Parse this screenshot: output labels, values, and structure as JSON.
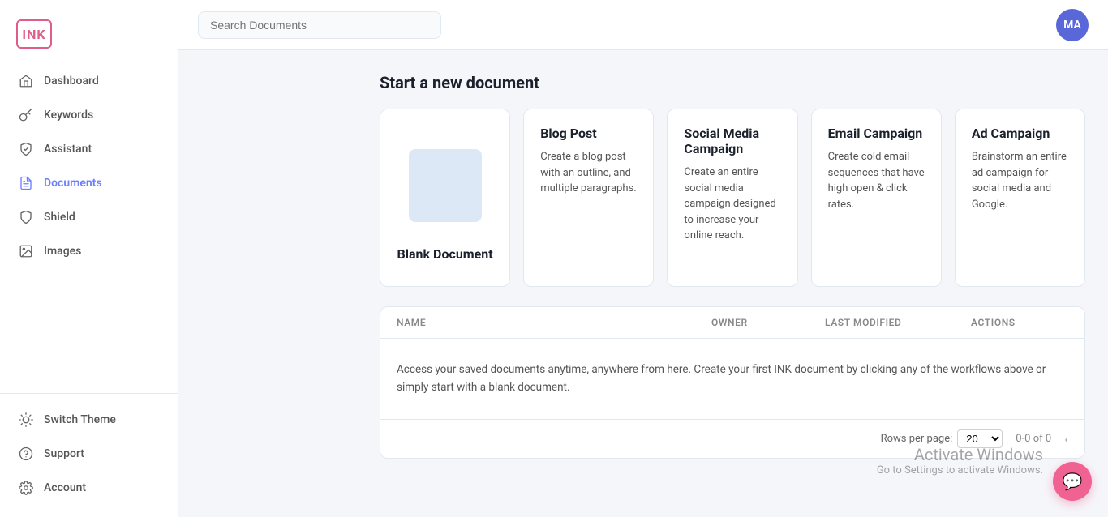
{
  "logo": {
    "text": "INK"
  },
  "topbar": {
    "search_placeholder": "Search Documents",
    "avatar_initials": "MA"
  },
  "sidebar": {
    "nav_items": [
      {
        "id": "dashboard",
        "label": "Dashboard",
        "icon": "home",
        "active": false
      },
      {
        "id": "keywords",
        "label": "Keywords",
        "icon": "key",
        "active": false
      },
      {
        "id": "assistant",
        "label": "Assistant",
        "icon": "shield-check",
        "active": false
      },
      {
        "id": "documents",
        "label": "Documents",
        "icon": "file",
        "active": true
      },
      {
        "id": "shield",
        "label": "Shield",
        "icon": "shield",
        "active": false
      },
      {
        "id": "images",
        "label": "Images",
        "icon": "image",
        "active": false
      }
    ],
    "bottom_items": [
      {
        "id": "switch-theme",
        "label": "Switch Theme",
        "icon": "sun"
      },
      {
        "id": "support",
        "label": "Support",
        "icon": "help-circle"
      },
      {
        "id": "account",
        "label": "Account",
        "icon": "settings"
      }
    ]
  },
  "main": {
    "section_title": "Start a new document",
    "cards": [
      {
        "id": "blank",
        "title": "Blank Document",
        "desc": "",
        "is_blank": true
      },
      {
        "id": "blog-post",
        "title": "Blog Post",
        "desc": "Create a blog post with an outline, and multiple paragraphs.",
        "is_blank": false
      },
      {
        "id": "social-media",
        "title": "Social Media Campaign",
        "desc": "Create an entire social media campaign designed to increase your online reach.",
        "is_blank": false
      },
      {
        "id": "email-campaign",
        "title": "Email Campaign",
        "desc": "Create cold email sequences that have high open & click rates.",
        "is_blank": false
      },
      {
        "id": "ad-campaign",
        "title": "Ad Campaign",
        "desc": "Brainstorm an entire ad campaign for social media and Google.",
        "is_blank": false
      }
    ],
    "table": {
      "columns": [
        "Name",
        "Owner",
        "Last Modified",
        "Actions"
      ],
      "empty_message": "Access your saved documents anytime, anywhere from here. Create your first INK document by clicking any of the workflows above or simply start with a blank document.",
      "rows_per_page_label": "Rows per page:",
      "rows_per_page_value": "20",
      "pagination_info": "0-0 of 0"
    }
  },
  "activate_windows": {
    "line1": "Activate Windows",
    "line2": "Go to Settings to activate Windows."
  }
}
